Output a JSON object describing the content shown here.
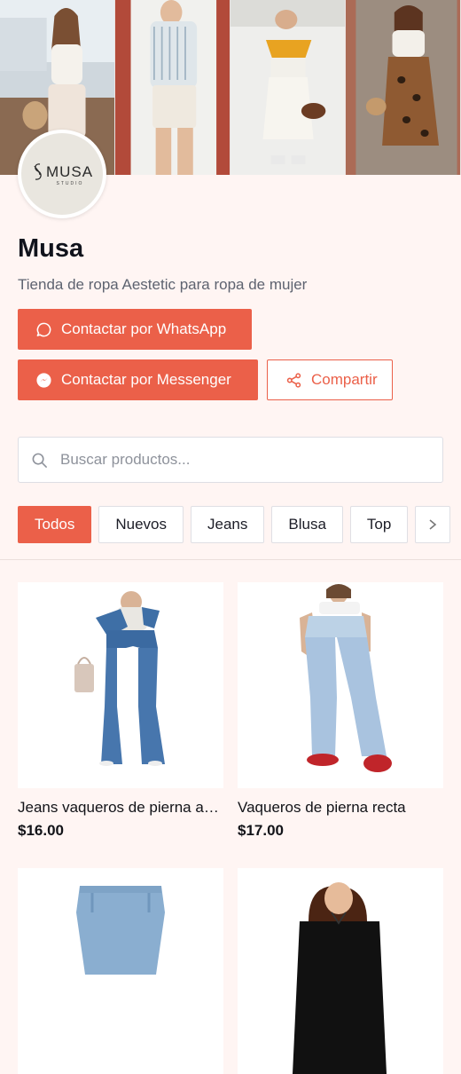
{
  "colors": {
    "accent": "#eb6049",
    "page_background": "#fff5f3",
    "text": "#11131c",
    "muted": "#5d6370"
  },
  "store": {
    "logo_text": "MUSA",
    "logo_subtext": "STUDIO",
    "name": "Musa",
    "description": "Tienda de ropa Aestetic para ropa de mujer"
  },
  "actions": {
    "whatsapp_label": "Contactar por WhatsApp",
    "whatsapp_icon": "whatsapp-chat-icon",
    "messenger_label": "Contactar por Messenger",
    "messenger_icon": "messenger-icon",
    "share_label": "Compartir",
    "share_icon": "share-icon"
  },
  "search": {
    "placeholder": "Buscar productos...",
    "value": "",
    "icon": "search-icon"
  },
  "categories": [
    {
      "label": "Todos",
      "active": true
    },
    {
      "label": "Nuevos",
      "active": false
    },
    {
      "label": "Jeans",
      "active": false
    },
    {
      "label": "Blusa",
      "active": false
    },
    {
      "label": "Top",
      "active": false
    }
  ],
  "products": [
    {
      "name": "Jeans vaqueros de pierna acampanada",
      "price": "$16.00"
    },
    {
      "name": "Vaqueros de pierna recta",
      "price": "$17.00"
    }
  ]
}
